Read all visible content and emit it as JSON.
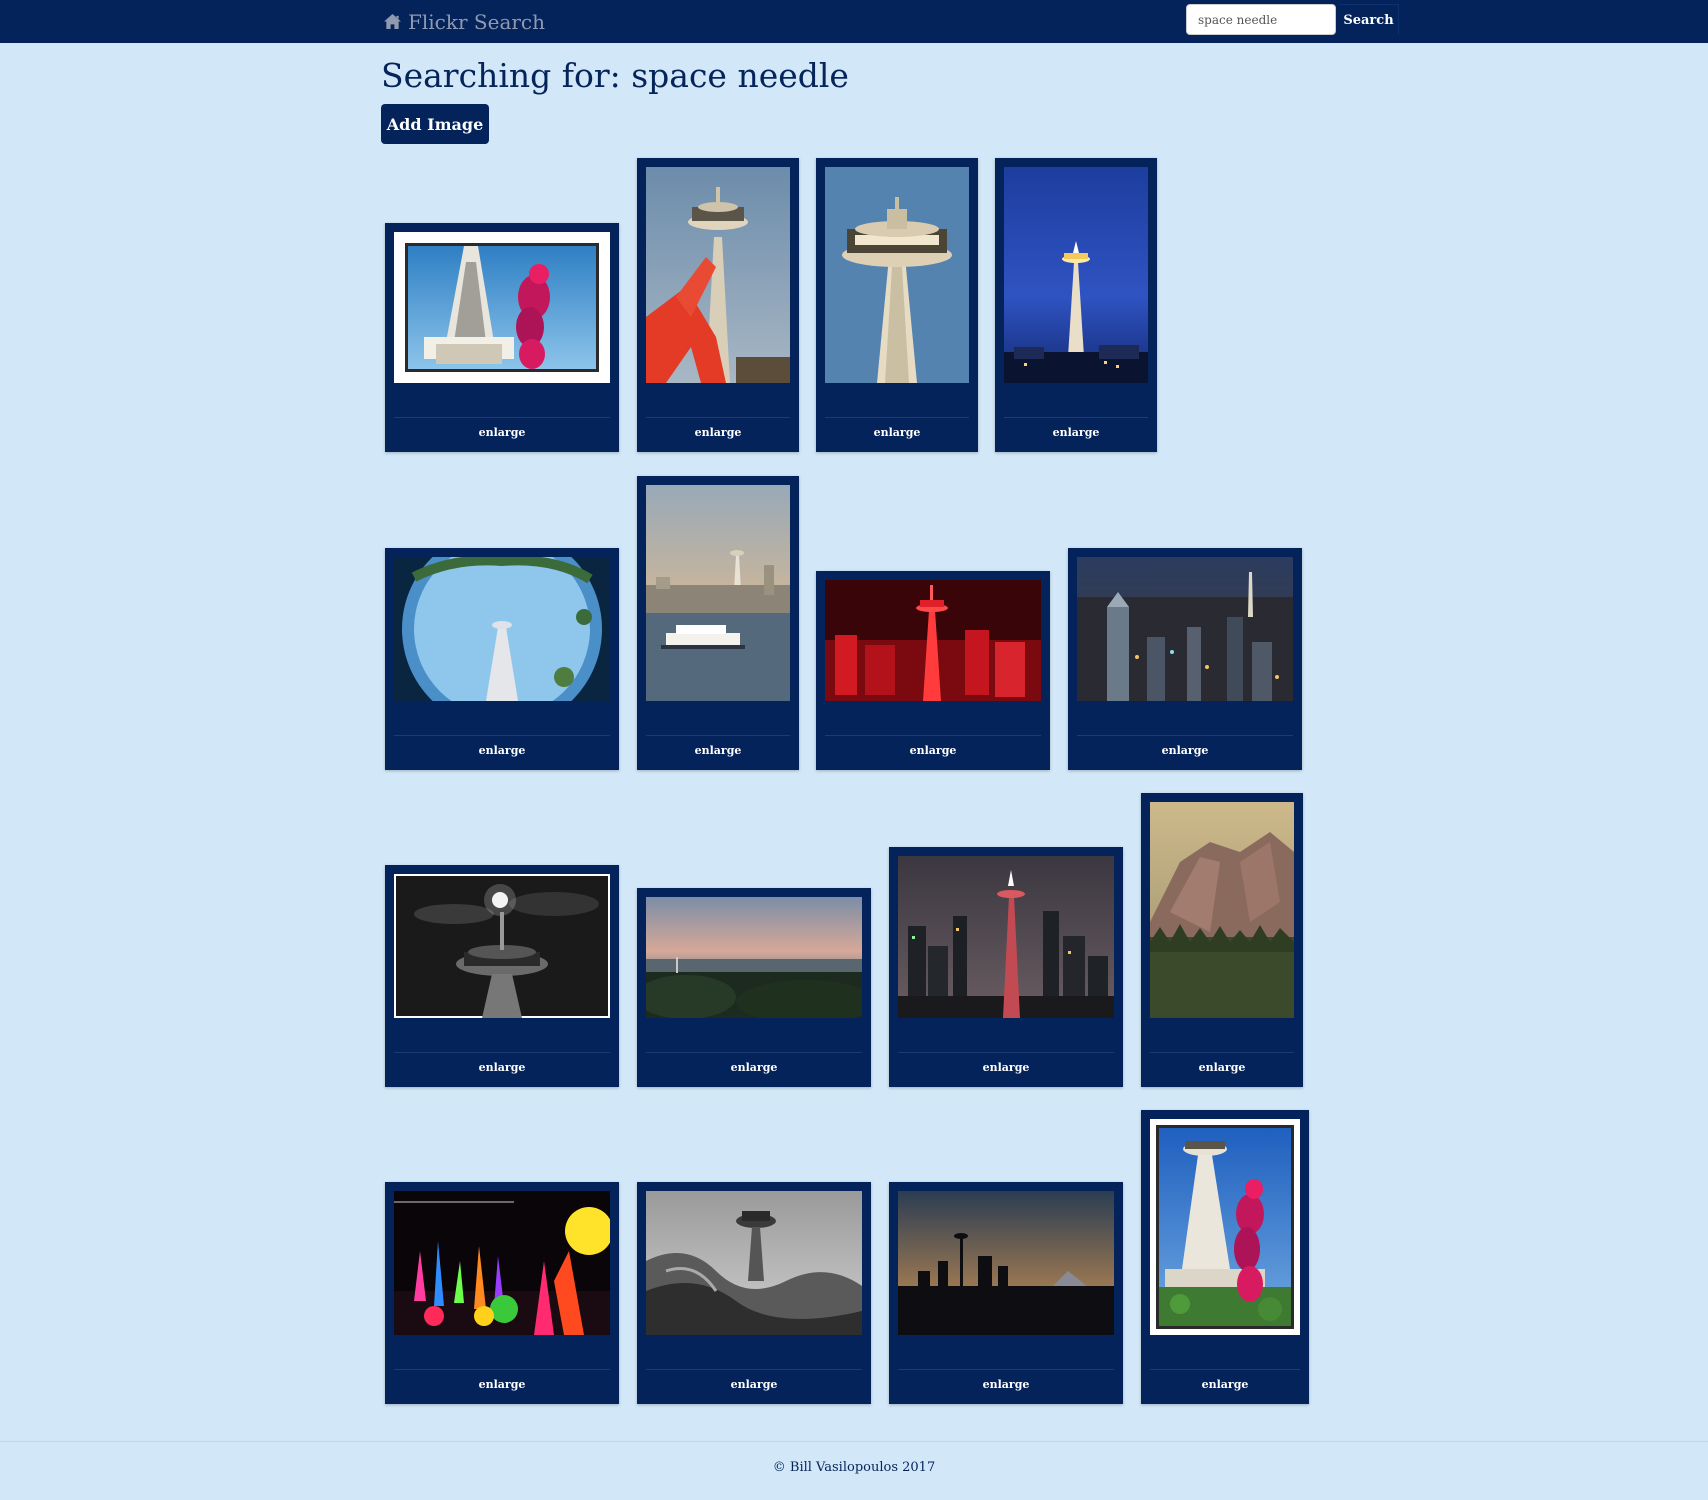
{
  "nav": {
    "brand": "Flickr Search",
    "search_value": "space needle",
    "search_button": "Search"
  },
  "main": {
    "title": "Searching for: space needle",
    "add_button": "Add Image"
  },
  "cards": [
    {
      "label": "enlarge",
      "icon": "photo-needle-chihuly-framed"
    },
    {
      "label": "enlarge",
      "icon": "photo-needle-red-sculpture"
    },
    {
      "label": "enlarge",
      "icon": "photo-needle-top-closeup"
    },
    {
      "label": "enlarge",
      "icon": "photo-needle-blue-night"
    },
    {
      "label": "enlarge",
      "icon": "photo-needle-fisheye"
    },
    {
      "label": "enlarge",
      "icon": "photo-needle-ferry"
    },
    {
      "label": "enlarge",
      "icon": "photo-needle-red-model"
    },
    {
      "label": "enlarge",
      "icon": "photo-city-aerial-night"
    },
    {
      "label": "enlarge",
      "icon": "photo-needle-moon-bw"
    },
    {
      "label": "enlarge",
      "icon": "photo-sunset-bay"
    },
    {
      "label": "enlarge",
      "icon": "photo-needle-dusk-skyline"
    },
    {
      "label": "enlarge",
      "icon": "photo-mountain-cliff"
    },
    {
      "label": "enlarge",
      "icon": "photo-chihuly-glass"
    },
    {
      "label": "enlarge",
      "icon": "photo-needle-emp-bw"
    },
    {
      "label": "enlarge",
      "icon": "photo-skyline-silhouette"
    },
    {
      "label": "enlarge",
      "icon": "photo-needle-chihuly-portrait"
    }
  ],
  "footer": {
    "text": "© Bill Vasilopoulos 2017"
  },
  "colors": {
    "navbar": "#04235a",
    "background": "#d2e8f8",
    "card": "#04235a",
    "text": "#05245a"
  }
}
